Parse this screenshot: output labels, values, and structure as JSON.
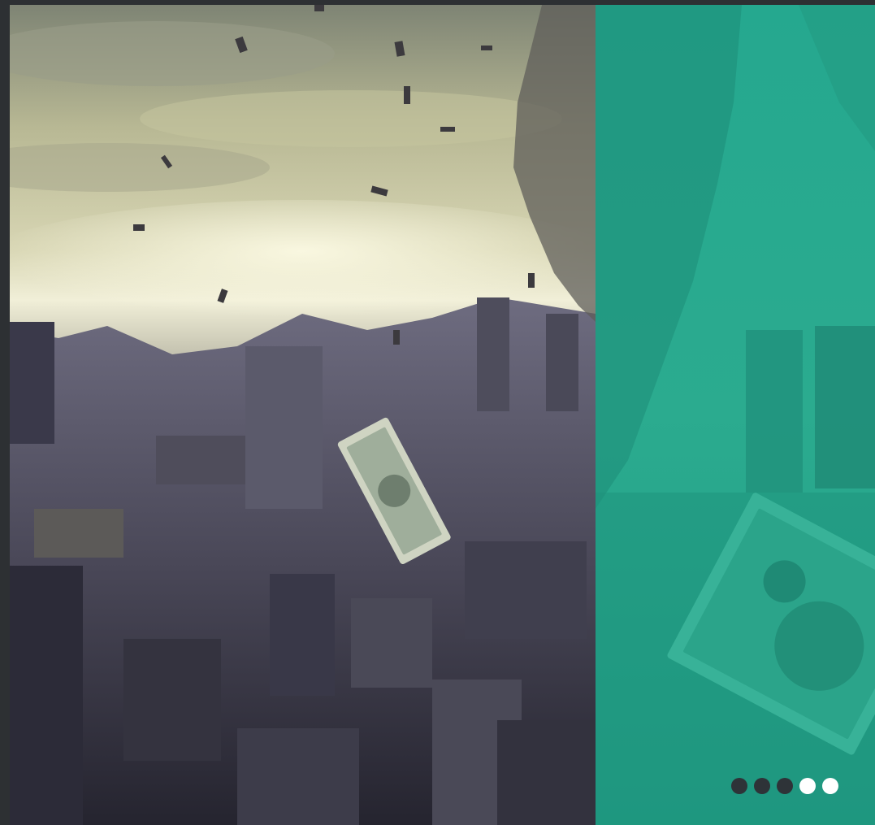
{
  "slider": {
    "images": {
      "left": "city-skyline-money-storm-photo",
      "right": "teal-overlay-dollar-bill-photo"
    },
    "colors": {
      "background": "#2d3033",
      "teal": "#27a48d",
      "dot_active": "#2e3338",
      "dot_inactive": "#ffffff"
    },
    "dots": [
      {
        "state": "filled"
      },
      {
        "state": "filled"
      },
      {
        "state": "filled"
      },
      {
        "state": "empty"
      },
      {
        "state": "empty"
      }
    ]
  }
}
